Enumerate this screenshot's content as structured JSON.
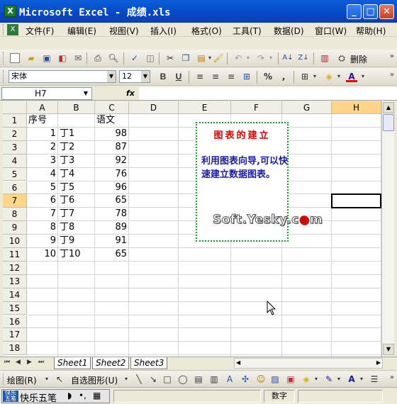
{
  "window": {
    "title": "Microsoft Excel - 成绩.xls",
    "icon": "excel-icon"
  },
  "menu": [
    "文件(F)",
    "编辑(E)",
    "视图(V)",
    "插入(I)",
    "格式(O)",
    "工具(T)",
    "数据(D)",
    "窗口(W)",
    "帮助(H)"
  ],
  "standard_toolbar": {
    "delete_label": "删除"
  },
  "format_toolbar": {
    "font_name": "宋体",
    "font_size": "12",
    "bold": "B",
    "underline": "U",
    "percent": "%",
    "comma": ","
  },
  "formula_bar": {
    "name_box": "H7",
    "fx": "fx",
    "content": ""
  },
  "columns": [
    "A",
    "B",
    "C",
    "D",
    "E",
    "F",
    "G",
    "H"
  ],
  "selected_column": "H",
  "rows": [
    "1",
    "2",
    "3",
    "4",
    "5",
    "6",
    "7",
    "8",
    "9",
    "10",
    "11",
    "12",
    "13",
    "14",
    "15",
    "16",
    "17",
    "18"
  ],
  "selected_row": "7",
  "cells": {
    "A1": "序号",
    "C1": "语文",
    "A": [
      "1",
      "2",
      "3",
      "4",
      "5",
      "6",
      "7",
      "8",
      "9",
      "10"
    ],
    "B": [
      "丁1",
      "丁2",
      "丁3",
      "丁4",
      "丁5",
      "丁6",
      "丁7",
      "丁8",
      "丁9",
      "丁10"
    ],
    "C": [
      "98",
      "87",
      "92",
      "76",
      "96",
      "65",
      "78",
      "89",
      "91",
      "65"
    ]
  },
  "note": {
    "heading": "图表的建立",
    "body": "利用图表向导,可以快速建立数据图表。"
  },
  "watermark": {
    "text_before": "Soft.Yesky.c",
    "text_after": "m"
  },
  "sheet_tabs": [
    "Sheet1",
    "Sheet2",
    "Sheet3"
  ],
  "active_sheet": "Sheet1",
  "draw_toolbar": {
    "draw_label": "绘图(R)",
    "autoshape_label": "自选图形(U)"
  },
  "status_bar": {
    "ime_name": "快乐五笔",
    "ime_logo": "快乐\n五笔",
    "num_indicator": "数字"
  }
}
